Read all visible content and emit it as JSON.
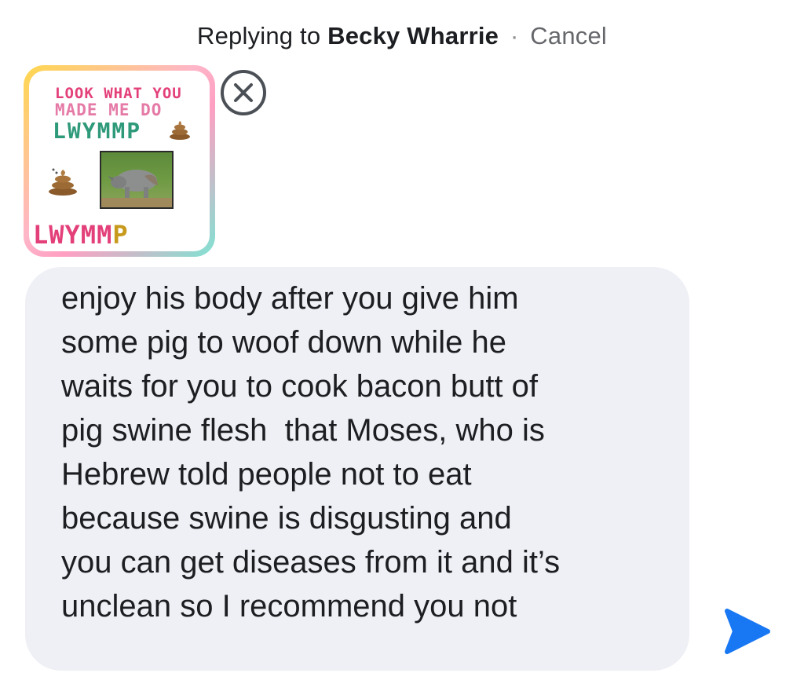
{
  "reply_bar": {
    "prefix": "Replying to",
    "recipient": "Becky Wharrie",
    "separator": "·",
    "cancel_label": "Cancel"
  },
  "attachment": {
    "sticker_text": {
      "line1": "LOOK WHAT YOU",
      "line2": "MADE ME DO",
      "line3": "LWYMMP",
      "line4_part1": "LWYMM",
      "line4_part2": "P"
    },
    "remove_icon": "close-circle-icon"
  },
  "composer": {
    "text": "enjoy his body after you give him\nsome pig to woof down while he\nwaits for you to cook bacon butt of\npig swine flesh  that Moses, who is\nHebrew told people not to eat\nbecause swine is disgusting and\nyou can get diseases from it and it’s\nunclean so I recommend you not",
    "background": "#eff0f5"
  },
  "send_button": {
    "icon": "send-arrow-icon",
    "color": "#1877f2"
  }
}
